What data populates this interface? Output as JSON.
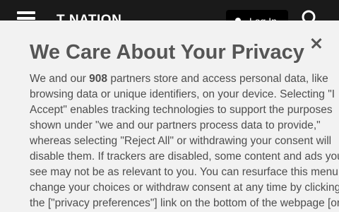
{
  "header": {
    "brand": "T NATION",
    "login_label": "Log In"
  },
  "modal": {
    "title": "We Care About Your Privacy",
    "close_label": "×",
    "body_lines": [
      [
        "We and our ",
        "908",
        " partners store and access personal data, like"
      ],
      "browsing data or unique identifiers, on your device. Selecting \"I",
      "Accept\" enables tracking technologies to support the purposes",
      "shown under \"we and our partners process data to provide,\"",
      "whereas selecting \"Reject All\" or withdrawing your consent will",
      "disable them. If trackers are disabled, some content and ads you",
      "see may not be as relevant to you. You can resurface this menu to",
      "change your choices or withdraw consent at any time by clicking",
      "the [\"privacy preferences\"] link on the bottom of the webpage [or"
    ]
  },
  "icons": {
    "menu": "hamburger-menu-icon",
    "user": "user-icon",
    "search": "search-icon",
    "close": "close-icon"
  }
}
